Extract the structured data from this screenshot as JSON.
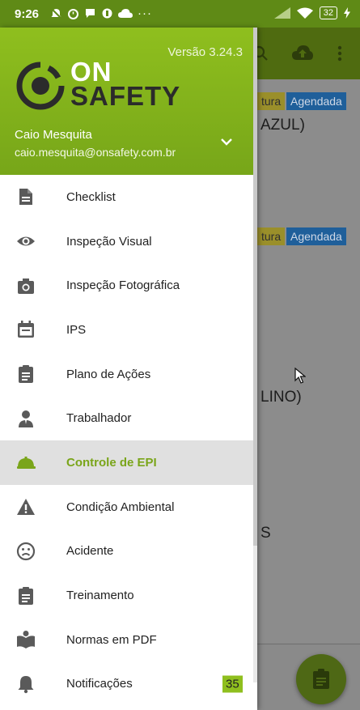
{
  "status_bar": {
    "time": "9:26",
    "battery": "32"
  },
  "background": {
    "cards": [
      {
        "tag1": "tura",
        "tag2": "Agendada",
        "text": "AZUL)"
      },
      {
        "tag1": "tura",
        "tag2": "Agendada",
        "text": ""
      },
      {
        "text": "LINO)"
      },
      {
        "text": "S"
      }
    ]
  },
  "drawer": {
    "version": "Versão 3.24.3",
    "logo_line1": "ON",
    "logo_line2": "SAFETY",
    "user_name": "Caio Mesquita",
    "user_email": "caio.mesquita@onsafety.com.br",
    "items": [
      {
        "label": "Checklist",
        "icon": "document-icon"
      },
      {
        "label": "Inspeção Visual",
        "icon": "eye-icon"
      },
      {
        "label": "Inspeção Fotográfica",
        "icon": "camera-icon"
      },
      {
        "label": "IPS",
        "icon": "calendar-icon"
      },
      {
        "label": "Plano de Ações",
        "icon": "clipboard-icon"
      },
      {
        "label": "Trabalhador",
        "icon": "worker-icon"
      },
      {
        "label": "Controle de EPI",
        "icon": "helmet-icon",
        "active": true
      },
      {
        "label": "Condição Ambiental",
        "icon": "warning-icon"
      },
      {
        "label": "Acidente",
        "icon": "sad-face-icon"
      },
      {
        "label": "Treinamento",
        "icon": "clipboard-icon"
      },
      {
        "label": "Normas em PDF",
        "icon": "book-icon"
      },
      {
        "label": "Notificações",
        "icon": "bell-icon",
        "badge": "35"
      }
    ]
  },
  "colors": {
    "accent": "#8fbf1e",
    "active_label": "#7aa51a"
  }
}
